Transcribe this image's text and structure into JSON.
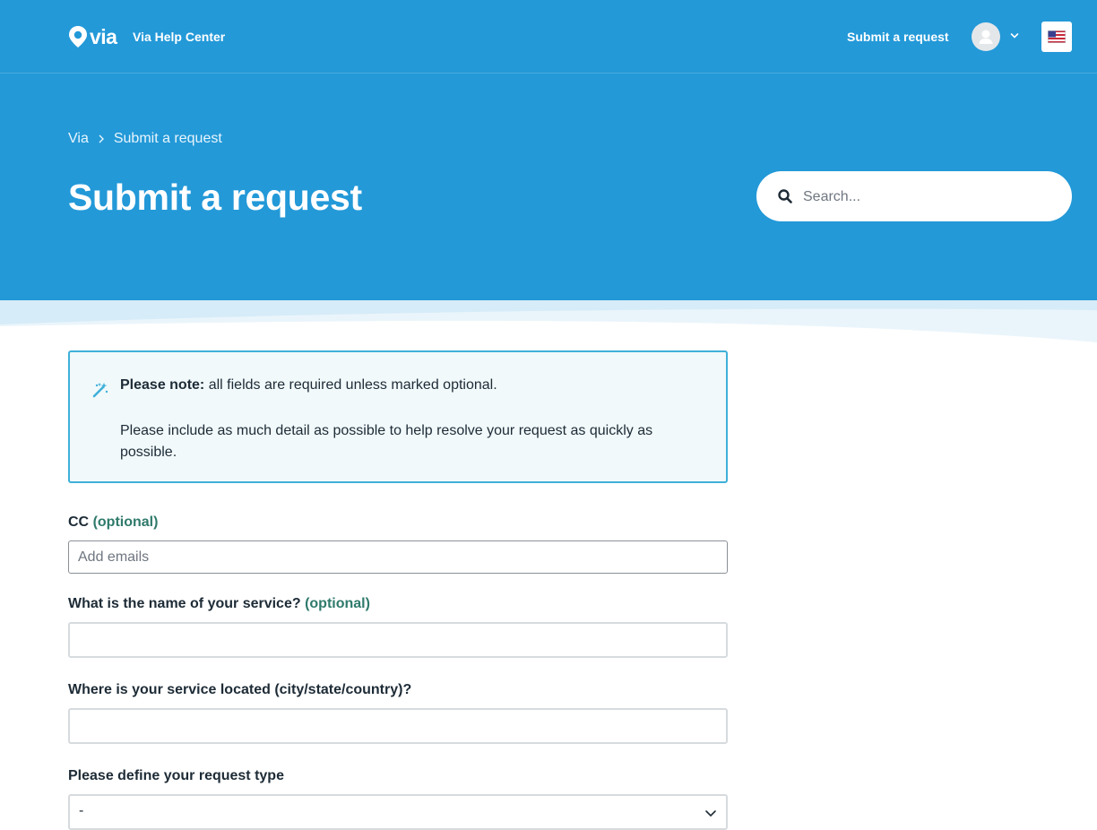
{
  "header": {
    "logo_text": "via",
    "brand_title": "Via Help Center",
    "nav_submit_label": "Submit a request",
    "user_menu_icon": "user-avatar-icon",
    "language_icon": "us-flag-icon"
  },
  "breadcrumb": {
    "items": [
      "Via",
      "Submit a request"
    ]
  },
  "page_title": "Submit a request",
  "search": {
    "placeholder": "Search...",
    "value": ""
  },
  "notice": {
    "icon": "magic-wand-icon",
    "bold_prefix": "Please note:",
    "line1": " all fields are required unless marked optional.",
    "line2": "Please include as much detail as possible to help resolve your request as quickly as possible."
  },
  "form": {
    "cc": {
      "label": "CC",
      "optional_label": "(optional)",
      "placeholder": "Add emails",
      "value": ""
    },
    "service_name": {
      "label": "What is the name of your service?",
      "optional_label": "(optional)",
      "value": ""
    },
    "service_location": {
      "label": "Where is your service located (city/state/country)?",
      "value": ""
    },
    "request_type": {
      "label": "Please define your request type",
      "selected": "-"
    }
  },
  "colors": {
    "hero_blue": "#2399d8",
    "notice_border": "#3fb0d9",
    "notice_bg": "#f1f9fb",
    "optional_green": "#2f7a6b",
    "text_dark": "#1d2b36"
  }
}
